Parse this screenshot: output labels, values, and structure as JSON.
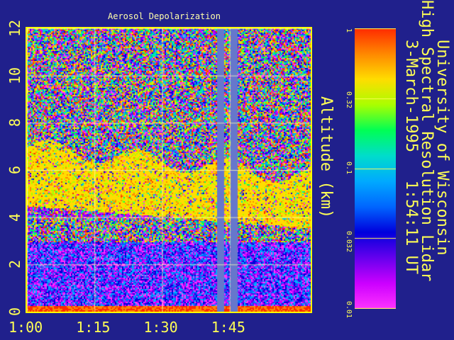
{
  "chart_data": {
    "type": "heatmap",
    "title": "Aerosol Depolarization",
    "ylabel": "Altitude (km)",
    "xlabel": "",
    "x_ticks": [
      "1:00",
      "1:15",
      "1:30",
      "1:45"
    ],
    "y_ticks": [
      "0",
      "2",
      "4",
      "6",
      "8",
      "10",
      "12"
    ],
    "ylim": [
      0,
      12
    ],
    "xlim_minutes": [
      60,
      123
    ],
    "grid": true,
    "colorbar": {
      "scale": "log",
      "range": [
        0.01,
        1
      ],
      "ticks": [
        "1",
        "0.32",
        "0.1",
        "0.032",
        "0.01"
      ],
      "colors": [
        "#ff2a00",
        "#ff8800",
        "#ffdd00",
        "#aaff00",
        "#00ff55",
        "#00ddcc",
        "#00aaff",
        "#0066ff",
        "#0000dd",
        "#6600ee",
        "#cc00ff",
        "#ff33ff"
      ]
    },
    "features": {
      "aerosol_layer_km": [
        4.5,
        7.0
      ],
      "data_gap_times": [
        "1:43",
        "1:46"
      ]
    }
  },
  "header": {
    "org": "University of Wisconsin",
    "instrument": "High Spectral Resolution Lidar",
    "date_time": "3-March-1995   1:54:11 UT"
  }
}
